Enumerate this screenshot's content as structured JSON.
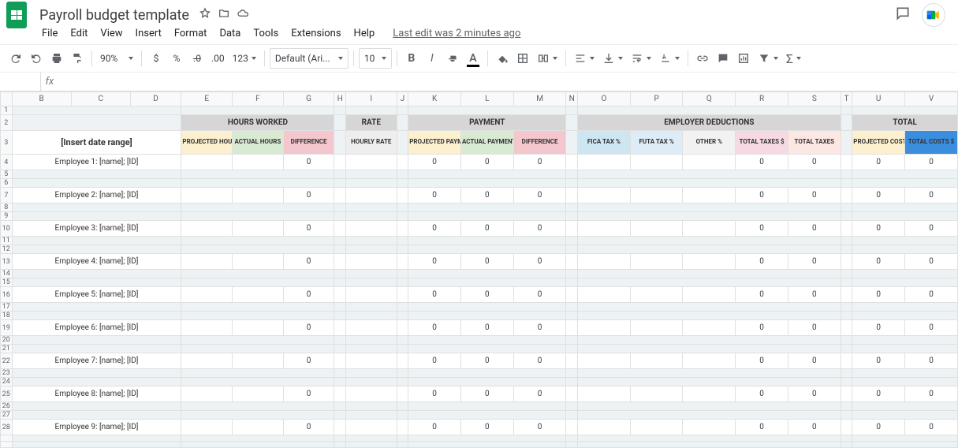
{
  "header": {
    "doc_title": "Payroll budget template",
    "last_edit": "Last edit was 2 minutes ago"
  },
  "menu": {
    "file": "File",
    "edit": "Edit",
    "view": "View",
    "insert": "Insert",
    "format": "Format",
    "data": "Data",
    "tools": "Tools",
    "extensions": "Extensions",
    "help": "Help"
  },
  "toolbar": {
    "zoom": "90%",
    "currency": "$",
    "percent": "%",
    "dec_dec": ".0",
    "inc_dec": ".00",
    "numfmt": "123",
    "font": "Default (Ari...",
    "size": "10",
    "bold": "B",
    "italic": "I"
  },
  "fx": {
    "label": "fx"
  },
  "columns": [
    "",
    "B",
    "C",
    "D",
    "E",
    "F",
    "G",
    "H",
    "I",
    "J",
    "K",
    "L",
    "M",
    "N",
    "O",
    "P",
    "Q",
    "R",
    "S",
    "T",
    "U",
    "V"
  ],
  "row_numbers": [
    "1",
    "2",
    "3",
    "4",
    "5",
    "6",
    "7",
    "8",
    "9",
    "10",
    "11",
    "12",
    "13",
    "14",
    "15",
    "16",
    "17",
    "18",
    "19",
    "20",
    "21",
    "22",
    "23",
    "24",
    "25",
    "26",
    "27",
    "28"
  ],
  "groups": {
    "hours": "HOURS WORKED",
    "rate": "RATE",
    "payment": "PAYMENT",
    "deductions": "EMPLOYER DEDUCTIONS",
    "total": "TOTAL"
  },
  "sub": {
    "date_range": "[Insert date range]",
    "proj_hours": "PROJECTED HOURS",
    "act_hours": "ACTUAL HOURS",
    "diff": "DIFFERENCE",
    "hourly_rate": "HOURLY RATE",
    "proj_pay": "PROJECTED PAYMENT $",
    "act_pay": "ACTUAL PAYMENT $",
    "fica": "FICA TAX %",
    "futa": "FUTA TAX %",
    "other": "OTHER %",
    "tot_tax_p": "TOTAL TAXES $",
    "tot_tax_a": "TOTAL TAXES",
    "tot_proj": "PROJECTED COSTS $",
    "tot_act": "TOTAL COSTS $"
  },
  "employees": [
    {
      "label": "Employee 1: [name]; [ID]"
    },
    {
      "label": "Employee 2: [name]; [ID]"
    },
    {
      "label": "Employee 3: [name]; [ID]"
    },
    {
      "label": "Employee 4: [name]; [ID]"
    },
    {
      "label": "Employee 5: [name]; [ID]"
    },
    {
      "label": "Employee 6: [name]; [ID]"
    },
    {
      "label": "Employee 7: [name]; [ID]"
    },
    {
      "label": "Employee 8: [name]; [ID]"
    },
    {
      "label": "Employee 9: [name]; [ID]"
    }
  ],
  "zero": "0"
}
